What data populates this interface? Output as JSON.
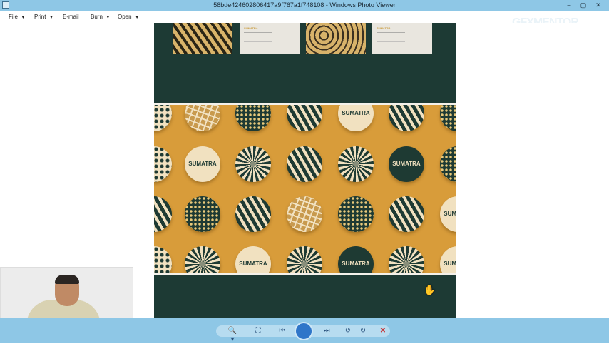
{
  "window": {
    "title": "58bde424602806417a9f767a1f748108 - Windows Photo Viewer",
    "controls": [
      "–",
      "▢",
      "✕"
    ]
  },
  "menu": {
    "items": [
      {
        "label": "File",
        "caret": "▾"
      },
      {
        "label": "Print",
        "caret": "▾"
      },
      {
        "label": "E-mail",
        "caret": ""
      },
      {
        "label": "Burn",
        "caret": "▾"
      },
      {
        "label": "Open",
        "caret": "▾"
      }
    ],
    "help": "?"
  },
  "image": {
    "brand_text": "SUMATRA",
    "colors": {
      "dark_green": "#1d3a34",
      "mustard": "#d89c3a",
      "cream": "#f1e1c0"
    }
  },
  "watermark": "GFXMENTOR",
  "toolbar": {
    "zoom": "🔍▾",
    "fit": "⛶",
    "previous": "⏮",
    "next": "⏭",
    "rotate_ccw": "↺",
    "rotate_cw": "↻",
    "delete": "✕"
  }
}
